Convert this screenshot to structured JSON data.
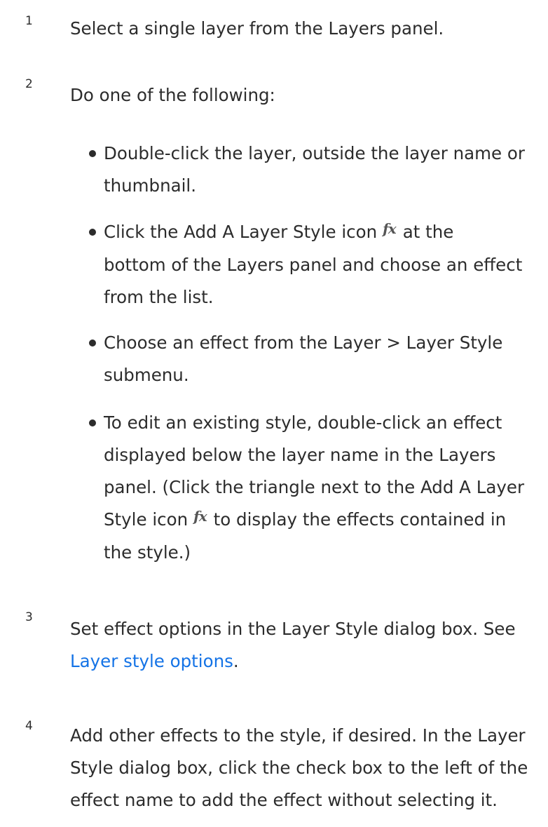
{
  "steps": [
    {
      "number": "1",
      "text": "Select a single layer from the Layers panel."
    },
    {
      "number": "2",
      "text": "Do one of the following:",
      "bullets": [
        {
          "lines": [
            "Double-click the layer, outside the layer name or",
            "thumbnail."
          ]
        },
        {
          "line1_before": "Click the Add A Layer Style icon",
          "line1_after": "at the",
          "lines_rest": [
            "bottom of the Layers panel and choose an effect",
            "from the list."
          ]
        },
        {
          "lines": [
            "Choose an effect from the Layer > Layer Style",
            "submenu."
          ]
        },
        {
          "lines_first": [
            "To edit an existing style, double-click an effect",
            "displayed below the layer name in the Layers",
            "panel. (Click the triangle next to the Add A Layer"
          ],
          "line4_before": "Style icon",
          "line4_after": "to display the effects contained in",
          "line5": "the style.)"
        }
      ]
    },
    {
      "number": "3",
      "line1": "Set effect options in the Layer Style dialog box. See",
      "link_text": "Layer style options",
      "after_link": "."
    },
    {
      "number": "4",
      "lines": [
        "Add other effects to the style, if desired. In the Layer",
        "Style dialog box, click the check box to the left of the",
        "effect name to add the effect without selecting it."
      ]
    }
  ],
  "icons": {
    "fx": "fx"
  },
  "colors": {
    "text": "#2c2c2c",
    "link": "#1473e6"
  }
}
